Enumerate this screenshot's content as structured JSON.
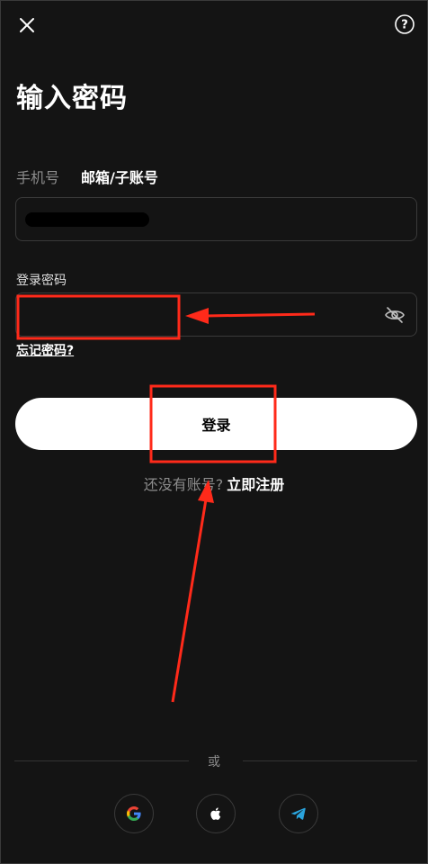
{
  "header": {
    "close_icon": "close-icon",
    "help_icon": "help-circle-icon",
    "help_glyph": "?"
  },
  "title": "输入密码",
  "tabs": [
    {
      "label": "手机号",
      "active": false
    },
    {
      "label": "邮箱/子账号",
      "active": true
    }
  ],
  "account_field": {
    "value": "",
    "redacted": true
  },
  "password": {
    "label": "登录密码",
    "value": "",
    "toggle_icon": "eye-off-icon"
  },
  "forgot_link": "忘记密码?",
  "login_button": "登录",
  "register": {
    "prompt": "还没有账号?",
    "link": "立即注册"
  },
  "divider": "或",
  "social": [
    {
      "icon": "google-icon"
    },
    {
      "icon": "apple-icon"
    },
    {
      "icon": "telegram-icon"
    }
  ],
  "colors": {
    "background": "#141414",
    "annotation_red": "#ff2a1a",
    "telegram_blue": "#2aa3dc"
  }
}
